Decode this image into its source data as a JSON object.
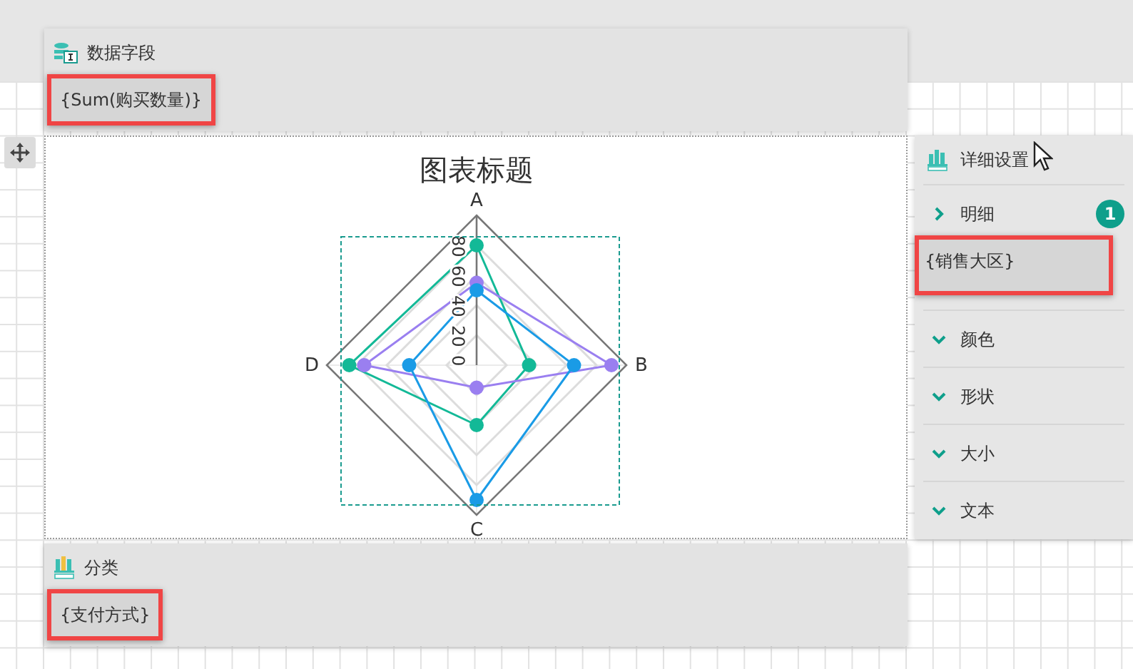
{
  "data_fields": {
    "title": "数据字段",
    "fields": [
      "{Sum(购买数量)}"
    ]
  },
  "chart": {
    "title": "图表标题",
    "chart_data": {
      "type": "radar",
      "categories": [
        "A",
        "B",
        "C",
        "D"
      ],
      "ylim": [
        0,
        100
      ],
      "yticks": [
        0,
        20,
        40,
        60,
        80
      ],
      "series": [
        {
          "color": "#13b997",
          "values": [
            80,
            35,
            40,
            85
          ]
        },
        {
          "color": "#9a7ff0",
          "values": [
            55,
            90,
            15,
            75
          ]
        },
        {
          "color": "#1a9be6",
          "values": [
            50,
            65,
            90,
            45
          ]
        }
      ]
    }
  },
  "details": {
    "title": "详细设置",
    "items": [
      {
        "label": "明细",
        "expanded": false,
        "badge": "1",
        "fields": [
          "{销售大区}"
        ]
      },
      {
        "label": "颜色",
        "expanded": true
      },
      {
        "label": "形状",
        "expanded": true
      },
      {
        "label": "大小",
        "expanded": true
      },
      {
        "label": "文本",
        "expanded": true
      }
    ]
  },
  "category": {
    "title": "分类",
    "fields": [
      "{支付方式}"
    ]
  }
}
